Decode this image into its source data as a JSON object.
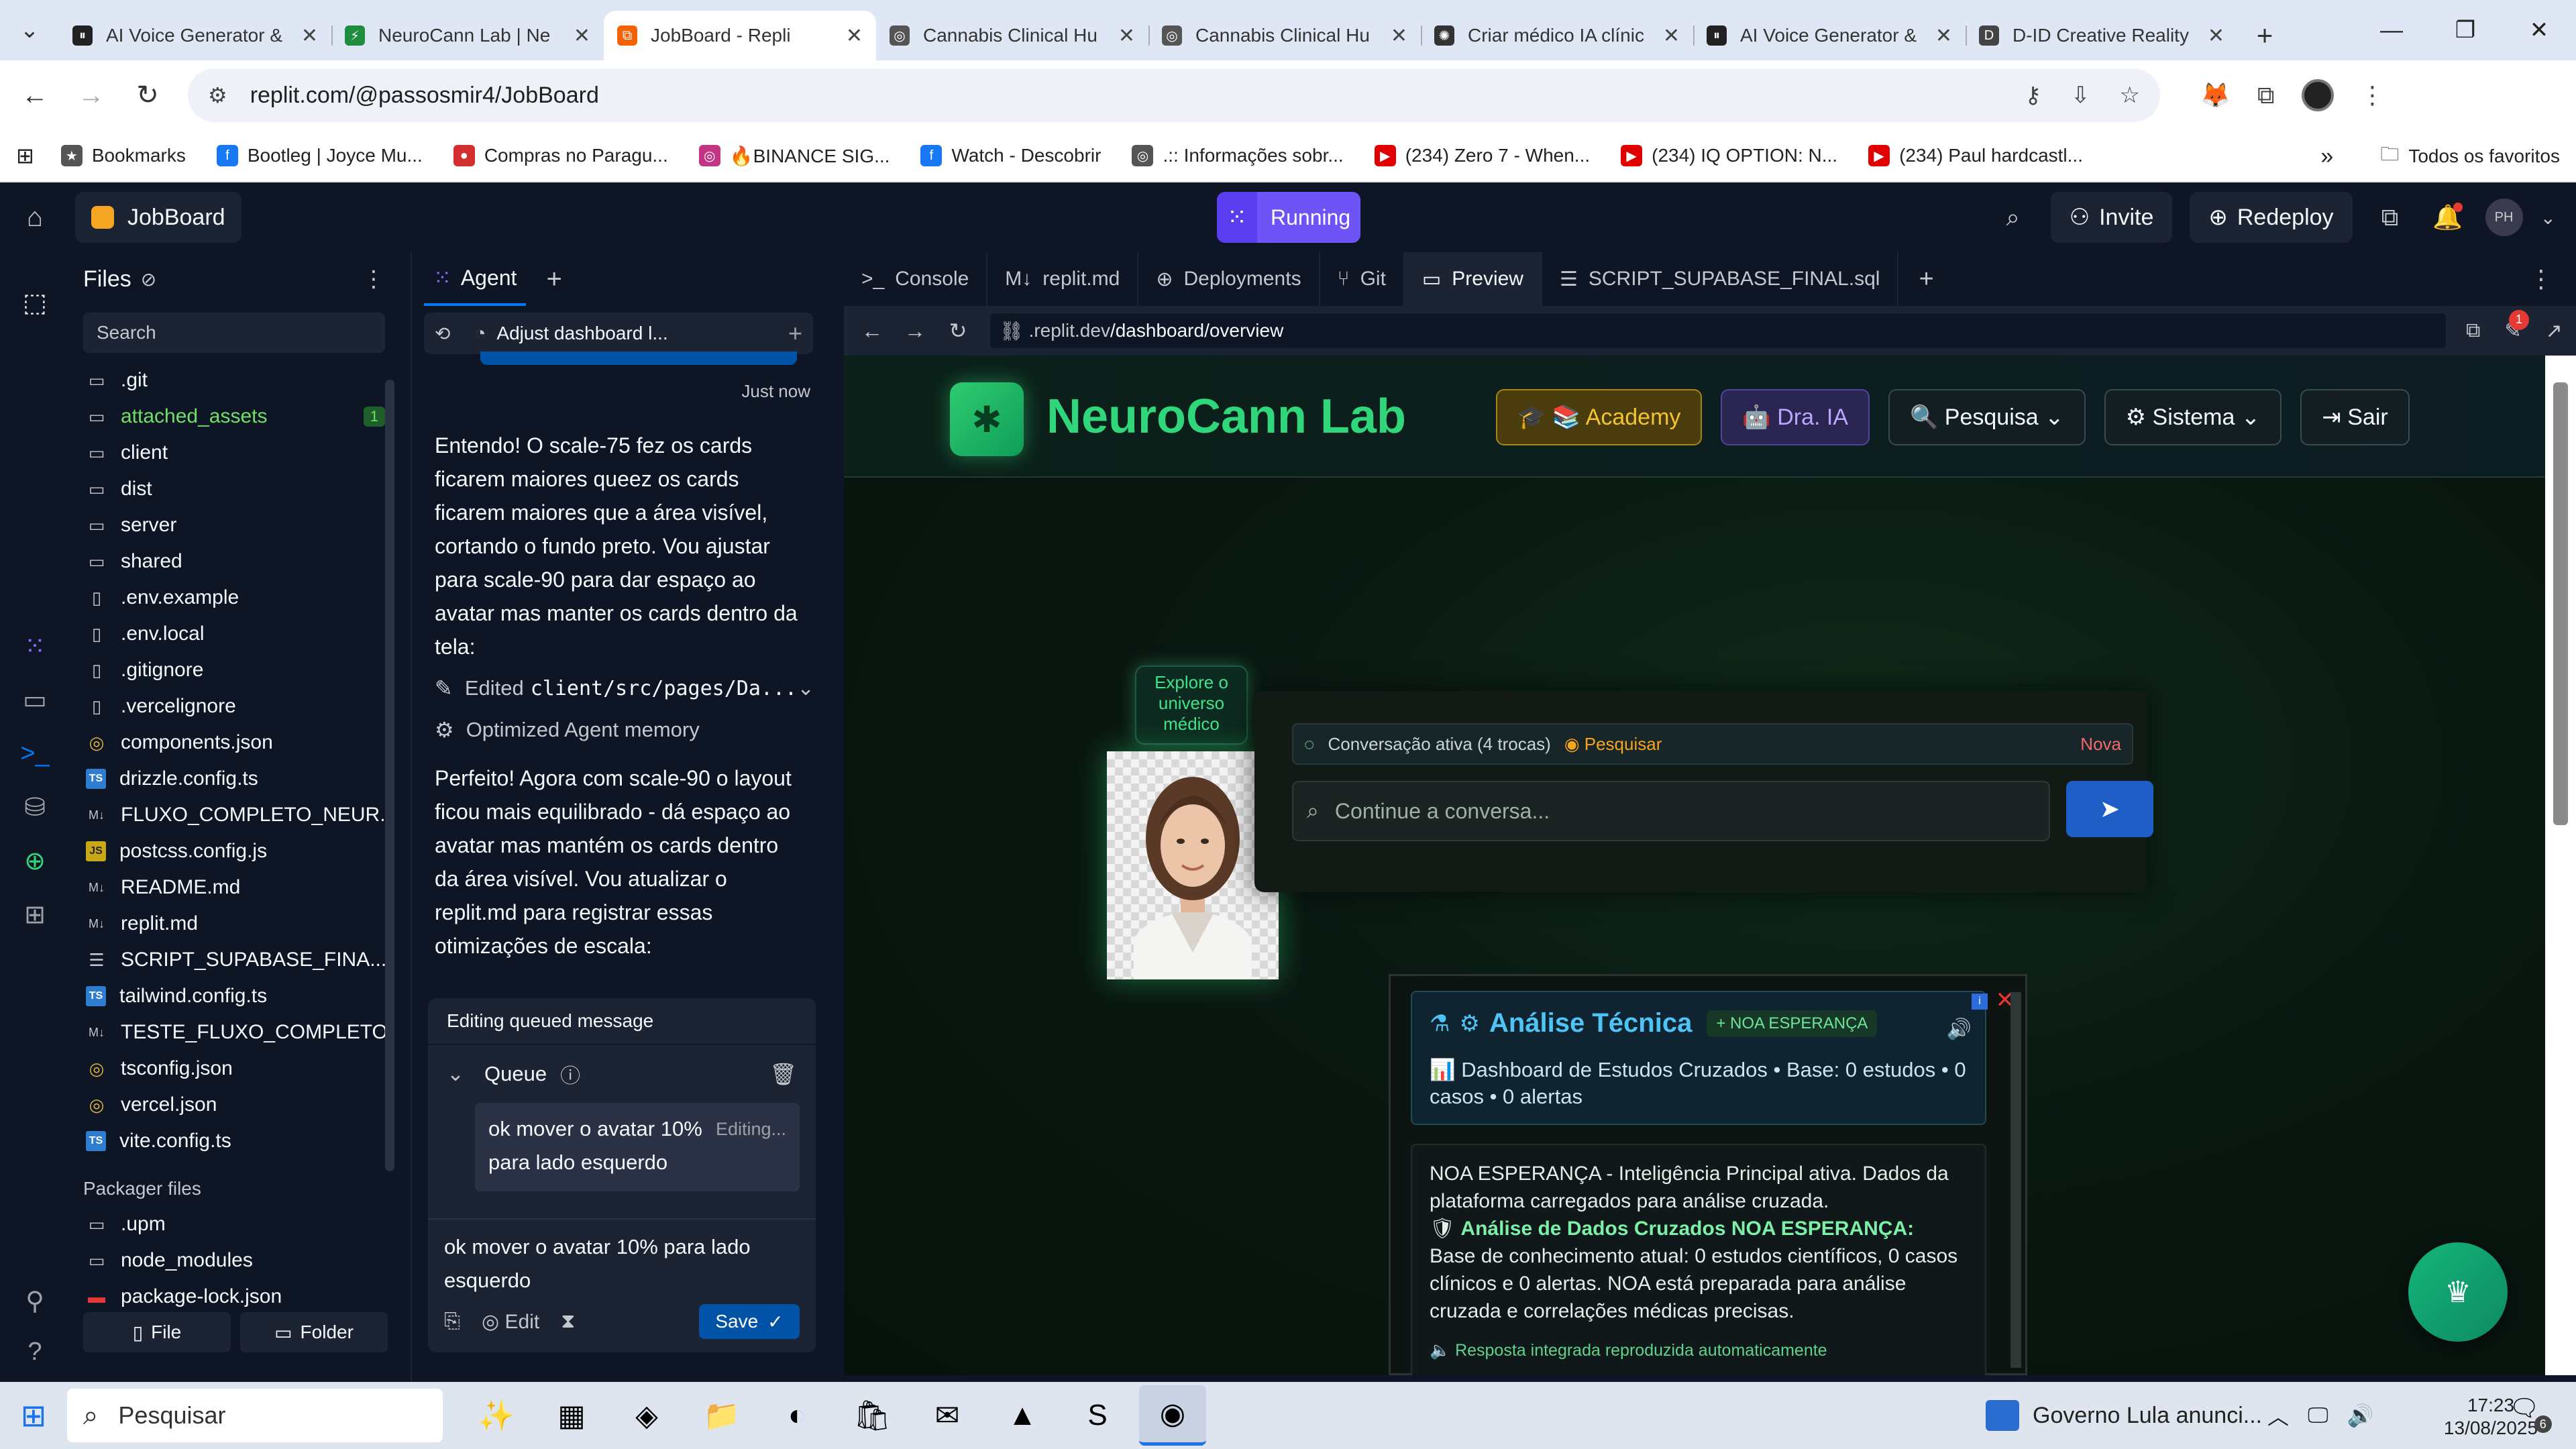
{
  "browser": {
    "tabs": [
      {
        "title": "AI Voice Generator &",
        "fav_color": "#222222",
        "fav_glyph": "⏸",
        "active": false
      },
      {
        "title": "NeuroCann Lab | Ne",
        "fav_color": "#1e8e3e",
        "fav_glyph": "⚡",
        "active": false
      },
      {
        "title": "JobBoard - Repli",
        "fav_color": "#f26207",
        "fav_glyph": "⧉",
        "active": true
      },
      {
        "title": "Cannabis Clinical Hu",
        "fav_color": "#555555",
        "fav_glyph": "◎",
        "active": false
      },
      {
        "title": "Cannabis Clinical Hu",
        "fav_color": "#555555",
        "fav_glyph": "◎",
        "active": false
      },
      {
        "title": "Criar médico IA clínic",
        "fav_color": "#333333",
        "fav_glyph": "✺",
        "active": false
      },
      {
        "title": "AI Voice Generator &",
        "fav_color": "#222222",
        "fav_glyph": "⏸",
        "active": false
      },
      {
        "title": "D-ID Creative Reality",
        "fav_color": "#444444",
        "fav_glyph": "D",
        "active": false
      }
    ],
    "url": "replit.com/@passosmir4/JobBoard",
    "bookmarks": [
      {
        "label": "Bookmarks",
        "color": "#555555",
        "glyph": "★"
      },
      {
        "label": "Bootleg | Joyce Mu...",
        "color": "#1877f2",
        "glyph": "f"
      },
      {
        "label": "Compras no Paragu...",
        "color": "#d32f2f",
        "glyph": "●"
      },
      {
        "label": "🔥BINANCE SIG...",
        "color": "#c13584",
        "glyph": "◎"
      },
      {
        "label": "Watch - Descobrir",
        "color": "#1877f2",
        "glyph": "f"
      },
      {
        "label": ".:: Informações sobr...",
        "color": "#555555",
        "glyph": "◎"
      },
      {
        "label": "(234) Zero 7 - When...",
        "color": "#e00000",
        "glyph": "▶"
      },
      {
        "label": "(234) IQ OPTION: N...",
        "color": "#e00000",
        "glyph": "▶"
      },
      {
        "label": "(234) Paul hardcastl...",
        "color": "#e00000",
        "glyph": "▶"
      }
    ],
    "bookmarks_more": "»",
    "all_bookmarks": "Todos os favoritos"
  },
  "replit": {
    "project_name": "JobBoard",
    "run_label": "Running",
    "invite_label": "Invite",
    "redeploy_label": "Redeploy",
    "avatar_initials": "PH"
  },
  "files": {
    "title": "Files",
    "search_placeholder": "Search",
    "items": [
      {
        "name": ".git",
        "icon": "folder",
        "glyph": "▭",
        "cls": ""
      },
      {
        "name": "attached_assets",
        "icon": "folder",
        "glyph": "▭",
        "cls": "green",
        "badge": "1"
      },
      {
        "name": "client",
        "icon": "folder",
        "glyph": "▭",
        "cls": ""
      },
      {
        "name": "dist",
        "icon": "folder",
        "glyph": "▭",
        "cls": ""
      },
      {
        "name": "server",
        "icon": "folder",
        "glyph": "▭",
        "cls": ""
      },
      {
        "name": "shared",
        "icon": "folder",
        "glyph": "▭",
        "cls": ""
      },
      {
        "name": ".env.example",
        "icon": "file",
        "glyph": "▯",
        "cls": ""
      },
      {
        "name": ".env.local",
        "icon": "file",
        "glyph": "▯",
        "cls": ""
      },
      {
        "name": ".gitignore",
        "icon": "file",
        "glyph": "▯",
        "cls": ""
      },
      {
        "name": ".vercelignore",
        "icon": "file",
        "glyph": "▯",
        "cls": ""
      },
      {
        "name": "components.json",
        "icon": "json",
        "glyph": "◎",
        "cls": "yel"
      },
      {
        "name": "drizzle.config.ts",
        "icon": "ts",
        "glyph": "TS",
        "cls": "ts"
      },
      {
        "name": "FLUXO_COMPLETO_NEUR...",
        "icon": "md",
        "glyph": "M↓",
        "cls": "md"
      },
      {
        "name": "postcss.config.js",
        "icon": "js",
        "glyph": "JS",
        "cls": "js"
      },
      {
        "name": "README.md",
        "icon": "md",
        "glyph": "M↓",
        "cls": "md"
      },
      {
        "name": "replit.md",
        "icon": "md",
        "glyph": "M↓",
        "cls": "md"
      },
      {
        "name": "SCRIPT_SUPABASE_FINA...",
        "icon": "db",
        "glyph": "☰",
        "cls": ""
      },
      {
        "name": "tailwind.config.ts",
        "icon": "ts",
        "glyph": "TS",
        "cls": "ts"
      },
      {
        "name": "TESTE_FLUXO_COMPLETO...",
        "icon": "md",
        "glyph": "M↓",
        "cls": "md"
      },
      {
        "name": "tsconfig.json",
        "icon": "json",
        "glyph": "◎",
        "cls": "yel"
      },
      {
        "name": "vercel.json",
        "icon": "json",
        "glyph": "◎",
        "cls": "yel"
      },
      {
        "name": "vite.config.ts",
        "icon": "ts",
        "glyph": "TS",
        "cls": "ts"
      }
    ],
    "packager_title": "Packager files",
    "packager_items": [
      {
        "name": ".upm",
        "glyph": "▭",
        "cls": ""
      },
      {
        "name": "node_modules",
        "glyph": "▭",
        "cls": ""
      },
      {
        "name": "package-lock.json",
        "glyph": "▬",
        "cls": "red"
      }
    ],
    "new_file_label": "File",
    "new_folder_label": "Folder"
  },
  "agent": {
    "tab_label": "Agent",
    "thread_title": "Adjust dashboard l...",
    "timestamp": "Just now",
    "message1": "Entendo! O scale-75 fez os cards ficarem maiores queez os cards ficarem maiores que a área visível, cortando o fundo preto. Vou ajustar para scale-90 para dar espaço ao avatar mas manter os cards dentro da tela:",
    "action_edit_prefix": "Edited",
    "action_edit_path": "client/src/pages/Da...",
    "action_memory": "Optimized Agent memory",
    "message2": "Perfeito! Agora com scale-90 o layout ficou mais equilibrado - dá espaço ao avatar mas mantém os cards dentro da área visível. Vou atualizar o replit.md para registrar essas otimizações de escala:",
    "queue_header": "Editing queued message",
    "queue_label": "Queue",
    "queue_item": "ok mover o avatar 10% para lado esquerdo",
    "queue_status": "Editing...",
    "compose_text": "ok mover o avatar 10% para lado esquerdo",
    "edit_label": "Edit",
    "save_label": "Save"
  },
  "workspace": {
    "tabs": [
      {
        "label": "Console",
        "glyph": ">_",
        "active": false
      },
      {
        "label": "replit.md",
        "glyph": "M↓",
        "active": false
      },
      {
        "label": "Deployments",
        "glyph": "⊕",
        "active": false
      },
      {
        "label": "Git",
        "glyph": "⑂",
        "active": false
      },
      {
        "label": "Preview",
        "glyph": "▭",
        "active": true
      },
      {
        "label": "SCRIPT_SUPABASE_FINAL.sql",
        "glyph": "☰",
        "active": false
      }
    ],
    "preview_host": ".replit.dev",
    "preview_path": "/dashboard/overview",
    "notif_count": "1"
  },
  "app": {
    "brand": "NeuroCann Lab",
    "nav": [
      {
        "label": "🎓 📚 Academy",
        "style": "academy"
      },
      {
        "label": "🤖 Dra. IA",
        "style": "dra"
      },
      {
        "label": "🔍 Pesquisa ⌄",
        "style": ""
      },
      {
        "label": "⚙ Sistema ⌄",
        "style": ""
      },
      {
        "label": "⇥   Sair",
        "style": ""
      }
    ],
    "explore_tag": "Explore o universo médico",
    "conversation_status": "Conversação ativa (4 trocas)",
    "search_link": "Pesquisar",
    "new_link": "Nova",
    "chat_placeholder": "Continue a conversa...",
    "analysis_title": "Análise Técnica",
    "analysis_badge": "+ NOA ESPERANÇA",
    "analysis_sub": "📊 Dashboard de Estudos Cruzados • Base: 0 estudos • 0 casos • 0 alertas",
    "analysis_body1": "NOA ESPERANÇA - Inteligência Principal ativa. Dados da plataforma carregados para análise cruzada.",
    "analysis_body_hl": "Análise de Dados Cruzados NOA ESPERANÇA:",
    "analysis_body2": "Base de conhecimento atual: 0 estudos científicos, 0 casos clínicos e 0 alertas. NOA está preparada para análise cruzada e correlações médicas precisas.",
    "analysis_footer": "🔈 Resposta integrada reproduzida automaticamente"
  },
  "taskbar": {
    "search_placeholder": "Pesquisar",
    "apps": [
      {
        "name": "widgets",
        "glyph": "✨",
        "active": false
      },
      {
        "name": "task-view",
        "glyph": "▦",
        "active": false
      },
      {
        "name": "copilot",
        "glyph": "◈",
        "active": false
      },
      {
        "name": "file-explorer",
        "glyph": "📁",
        "active": false
      },
      {
        "name": "edge",
        "glyph": "◐",
        "active": false
      },
      {
        "name": "store",
        "glyph": "🛍",
        "active": false
      },
      {
        "name": "outlook",
        "glyph": "✉",
        "active": false
      },
      {
        "name": "arc-app",
        "glyph": "▲",
        "active": false
      },
      {
        "name": "stake-app",
        "glyph": "S",
        "active": false
      },
      {
        "name": "chrome",
        "glyph": "◉",
        "active": true
      }
    ],
    "news": "Governo Lula anunci...",
    "time": "17:23",
    "date": "13/08/2025",
    "notif_count": "6"
  }
}
